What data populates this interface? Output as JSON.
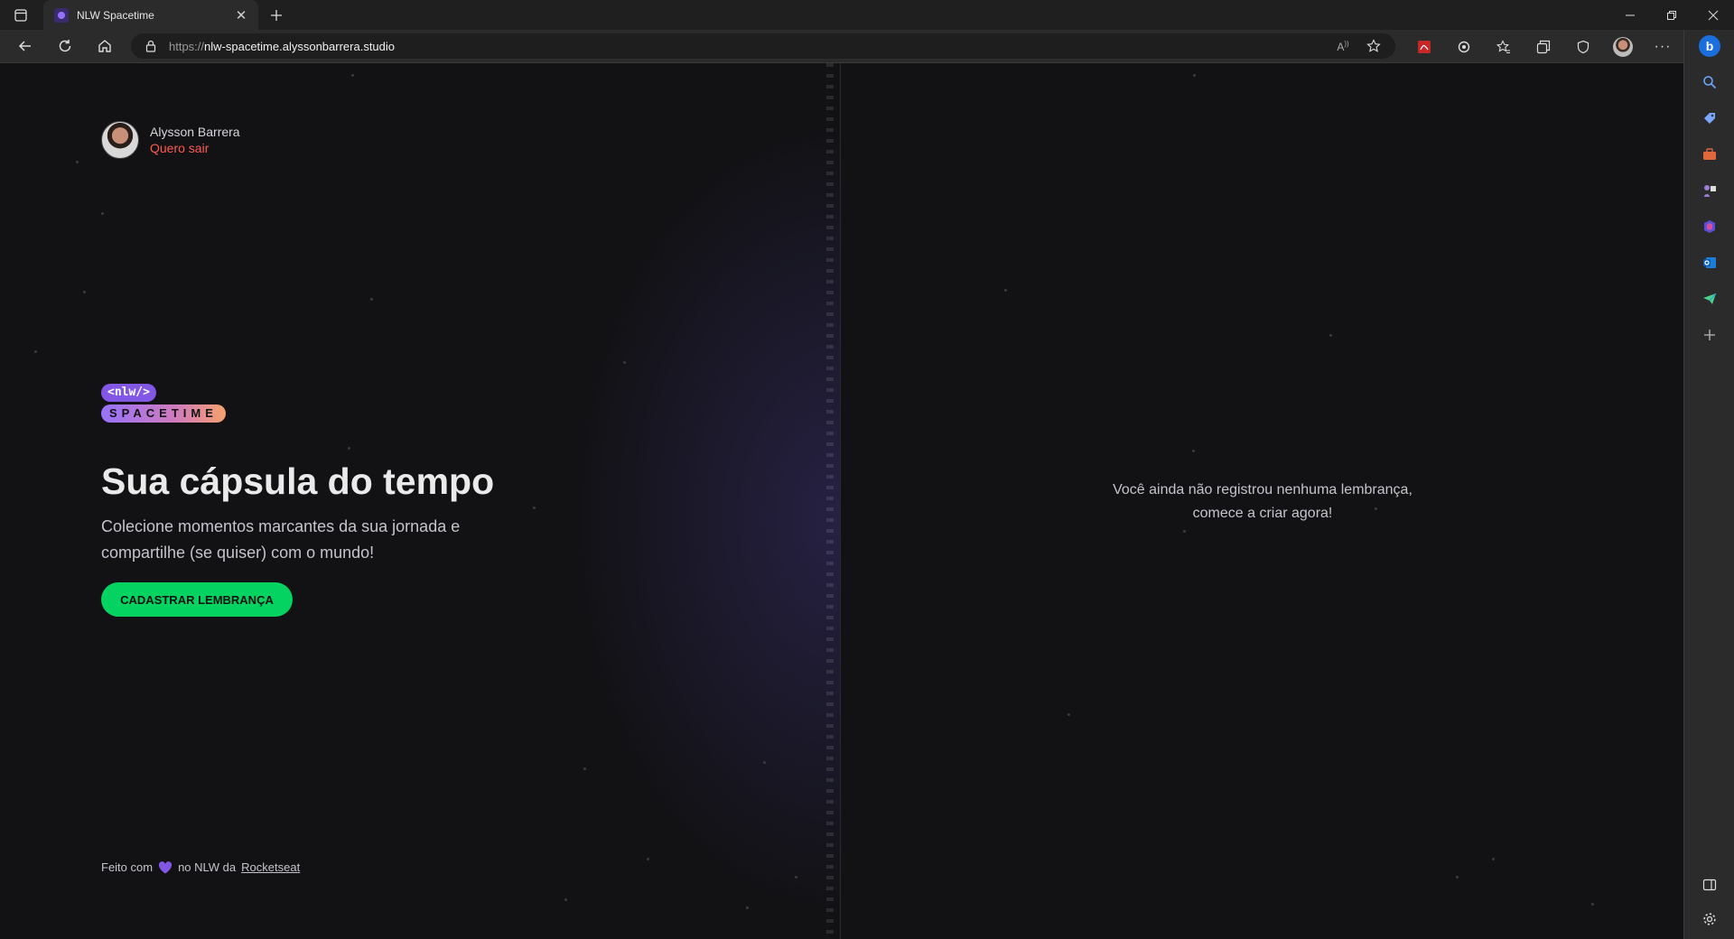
{
  "browser": {
    "tab_title": "NLW Spacetime",
    "url_scheme": "https://",
    "url_host": "nlw-spacetime.alyssonbarrera.studio",
    "icons": [
      "tab-actions-icon",
      "close-icon",
      "new-tab-icon",
      "back-icon",
      "refresh-icon",
      "home-icon",
      "lock-icon",
      "read-aloud-icon",
      "add-favorite-icon",
      "pdf-icon",
      "extensions-icon",
      "favorites-icon",
      "collections-icon",
      "browser-essentials-icon",
      "profile-avatar",
      "more-icon",
      "bing-icon",
      "search-icon",
      "shopping-icon",
      "tools-icon",
      "games-icon",
      "office-icon",
      "outlook-icon",
      "telegram-icon",
      "add-icon",
      "sidebar-toggle-icon",
      "settings-icon"
    ]
  },
  "user": {
    "name": "Alysson Barrera",
    "logout_label": "Quero sair"
  },
  "logo": {
    "top": "<nlw/>",
    "bottom": "SPACETIME"
  },
  "hero": {
    "title": "Sua cápsula do tempo",
    "subtitle": "Colecione momentos marcantes da sua jornada e compartilhe (se quiser) com o mundo!",
    "cta_label": "CADASTRAR LEMBRANÇA"
  },
  "footer": {
    "prefix": "Feito com",
    "middle": "no NLW da",
    "link": "Rocketseat"
  },
  "empty_state": {
    "line1": "Você ainda não registrou nenhuma lembrança,",
    "line2": "comece a criar agora!"
  },
  "colors": {
    "background": "#121215",
    "accent_green": "#04d361",
    "accent_purple": "#8257e5",
    "logout_red": "#ff5a4f",
    "heart": "#8257e5"
  }
}
